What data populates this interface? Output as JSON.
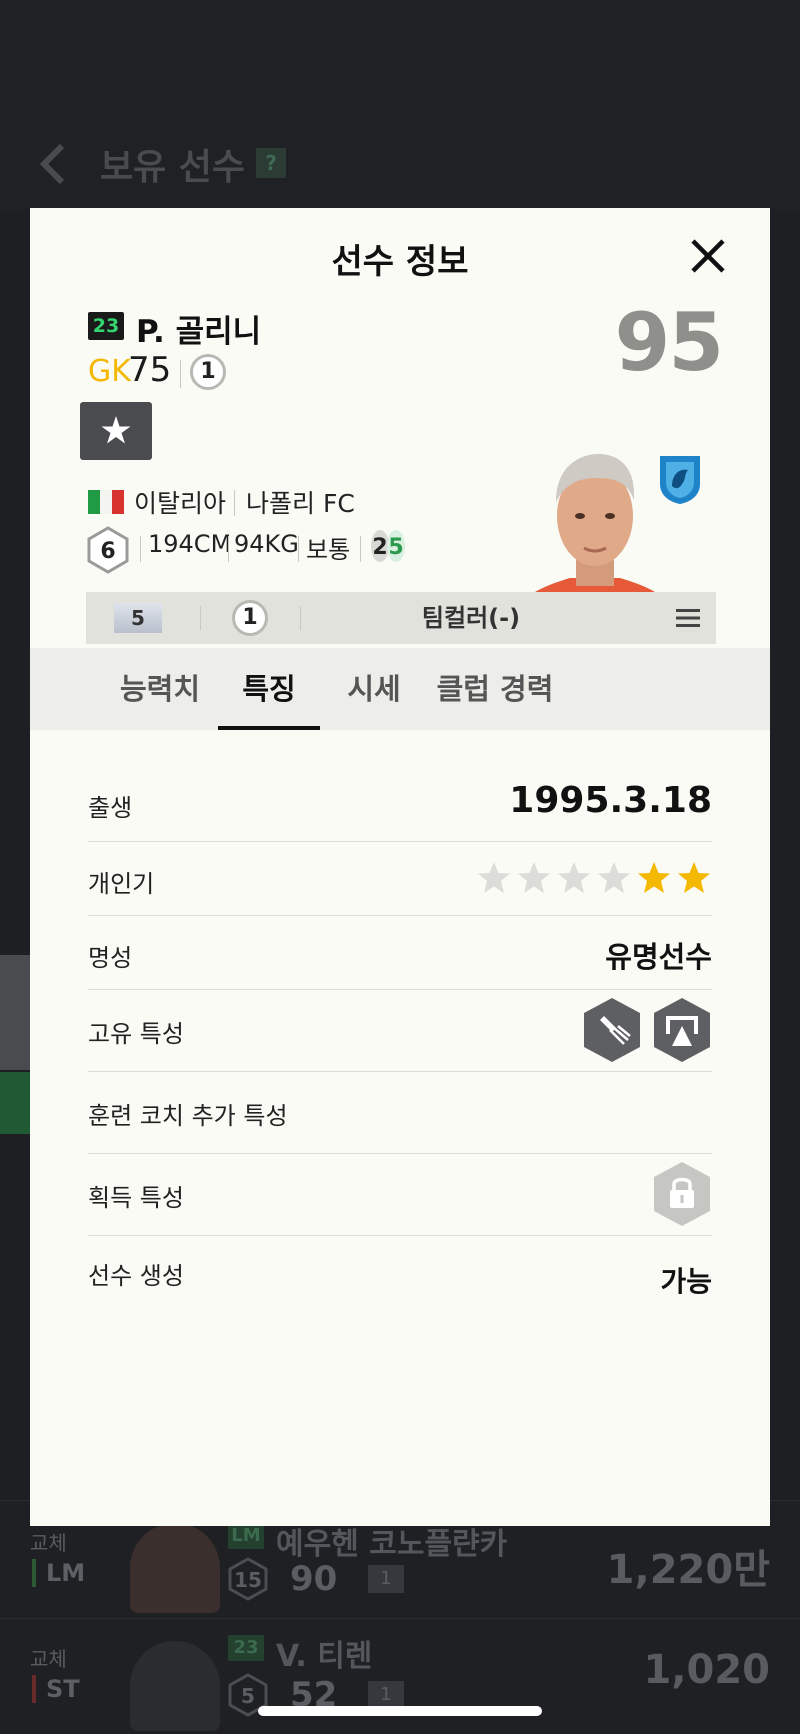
{
  "background": {
    "title": "보유 선수",
    "help": "?",
    "rows": [
      {
        "role": "교체",
        "pos": "LM",
        "name": "예우헨 코노플랸카",
        "number": "LM",
        "level": "15",
        "ovr": "90",
        "grade": "1",
        "price": "1,220만"
      },
      {
        "role": "교체",
        "pos": "ST",
        "name": "V. 티렌",
        "number": "23",
        "level": "5",
        "ovr": "52",
        "grade": "1",
        "price": "1,020"
      }
    ]
  },
  "modal": {
    "title": "선수 정보",
    "player": {
      "season_badge": "23",
      "name": "P. 골리니",
      "position": "GK",
      "position_ovr": "75",
      "grade": "1",
      "overall": "95",
      "nation": "이탈리아",
      "club": "나폴리 FC",
      "skill_level": "6",
      "height": "194CM",
      "weight": "94KG",
      "body_type": "보통",
      "foot_left": "2",
      "foot_right": "5"
    },
    "bar": {
      "level": "5",
      "grade": "1",
      "team_color": "팀컬러(-)"
    },
    "tabs": [
      {
        "label": "능력치"
      },
      {
        "label": "특징"
      },
      {
        "label": "시세"
      },
      {
        "label": "클럽 경력"
      }
    ],
    "details": {
      "birth_label": "출생",
      "birth_value": "1995.3.18",
      "popularity_label": "개인기",
      "popularity_stars": 2,
      "fame_label": "명성",
      "fame_value": "유명선수",
      "unique_traits_label": "고유 특성",
      "coach_traits_label": "훈련 코치 추가 특성",
      "acquired_traits_label": "획득 특성",
      "create_label": "선수 생성",
      "create_value": "가능"
    }
  },
  "colors": {
    "accent_yellow": "#f4b800",
    "jersey_green": "#34d46e",
    "modal_bg": "#fbfbf6"
  }
}
